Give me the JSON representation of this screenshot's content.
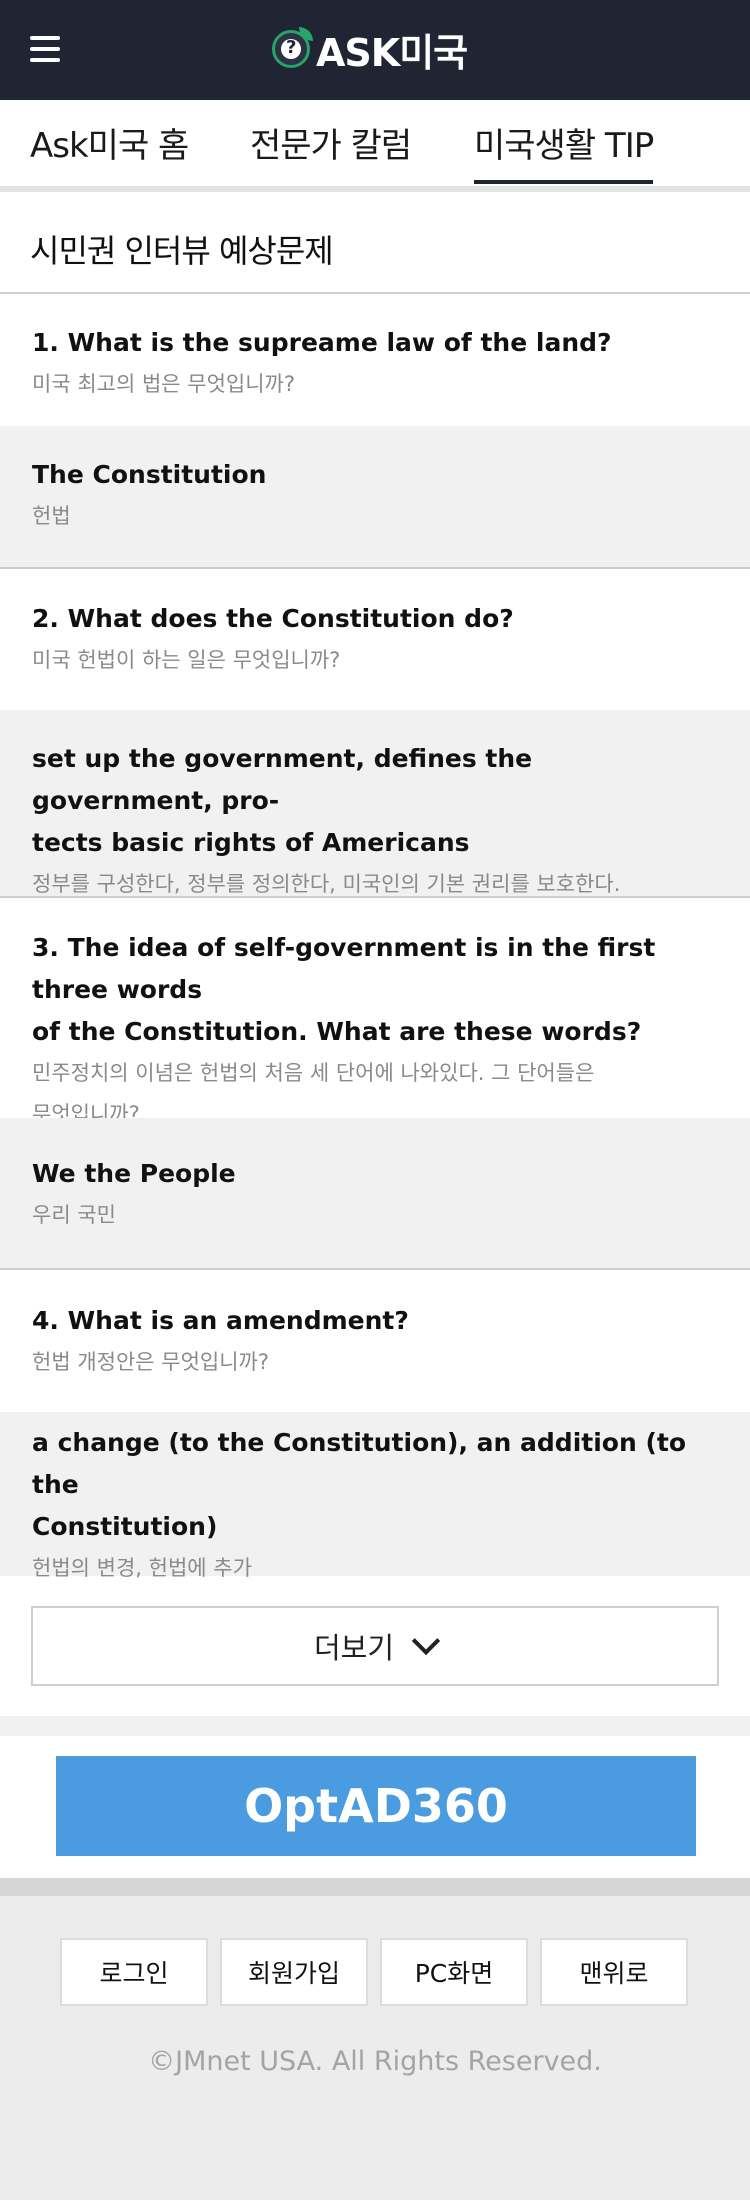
{
  "header": {
    "logo_text": "ASK미국",
    "menu_icon": "hamburger-menu-icon",
    "brand_colors": {
      "bar": "#1f2532",
      "leaf": "#27a36b"
    }
  },
  "tabs": [
    {
      "label": "Ask미국 홈",
      "active": false
    },
    {
      "label": "전문가 칼럼",
      "active": false
    },
    {
      "label": "미국생활 TIP",
      "active": true
    }
  ],
  "section": {
    "title": "시민권 인터뷰 예상문제"
  },
  "qa": [
    {
      "question_en": "1. What is the supreame law of the land?",
      "question_ko": "미국 최고의 법은 무엇입니까?",
      "answer_en": "The Constitution",
      "answer_ko": "헌법"
    },
    {
      "question_en": "2. What does the Constitution do?",
      "question_ko": "미국 헌법이 하는 일은 무엇입니까?",
      "answer_en_lines": [
        "set up the government, defines the government, pro-",
        "tects basic rights of Americans"
      ],
      "answer_ko": "정부를 구성한다, 정부를 정의한다, 미국인의 기본 권리를 보호한다."
    },
    {
      "question_en_lines": [
        "3. The idea of self-government is in the first three words",
        "of the Constitution. What are these words?"
      ],
      "question_ko_lines": [
        "민주정치의 이념은 헌법의 처음 세 단어에 나와있다. 그 단어들은",
        "무엇입니까?"
      ],
      "answer_en": "We the People",
      "answer_ko": "우리 국민"
    },
    {
      "question_en": "4. What is an amendment?",
      "question_ko": "헌법 개정안은 무엇입니까?",
      "answer_en_lines": [
        "a change (to the Constitution), an addition (to the",
        "Constitution)"
      ],
      "answer_ko": "헌법의 변경, 헌법에 추가"
    }
  ],
  "more_button": {
    "label": "더보기",
    "icon": "chevron-down-icon"
  },
  "ad": {
    "label": "OptAD360",
    "color": "#4b9be0"
  },
  "footer": {
    "buttons": [
      "로그인",
      "회원가입",
      "PC화면",
      "맨위로"
    ],
    "copyright": "©JMnet USA. All Rights Reserved."
  }
}
